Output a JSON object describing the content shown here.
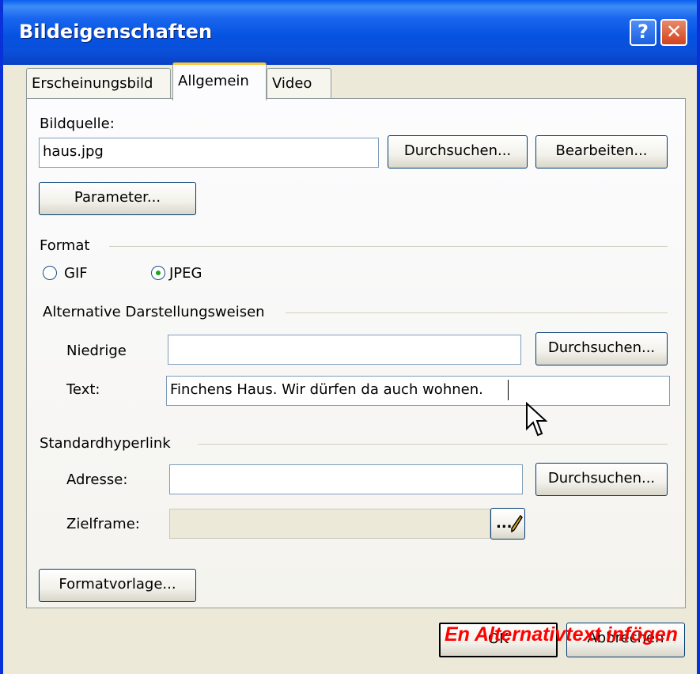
{
  "window": {
    "title": "Bildeigenschaften",
    "help_label": "?",
    "close_label": "✕"
  },
  "tabs": [
    {
      "label": "Erscheinungsbild"
    },
    {
      "label": "Allgemein",
      "selected": true
    },
    {
      "label": "Video"
    }
  ],
  "image_source": {
    "label": "Bildquelle:",
    "value": "haus.jpg",
    "browse_label": "Durchsuchen...",
    "edit_label": "Bearbeiten...",
    "parameters_label": "Parameter..."
  },
  "format": {
    "label": "Format",
    "options": [
      {
        "label": "GIF",
        "selected": false
      },
      {
        "label": "JPEG",
        "selected": true
      }
    ]
  },
  "alternatives": {
    "label": "Alternative Darstellungsweisen",
    "low_label": "Niedrige",
    "low_value": "",
    "browse_label": "Durchsuchen...",
    "text_label": "Text:",
    "text_value": "Finchens Haus. Wir dürfen da auch wohnen."
  },
  "hyperlink": {
    "label": "Standardhyperlink",
    "address_label": "Adresse:",
    "address_value": "",
    "browse_label": "Durchsuchen...",
    "target_label": "Zielframe:",
    "target_value": "",
    "target_button_label": "..."
  },
  "style_button_label": "Formatvorlage...",
  "footer": {
    "ok_label": "OK",
    "cancel_label": "Abbrechen"
  },
  "annotation": "En Alternativtext infögen"
}
